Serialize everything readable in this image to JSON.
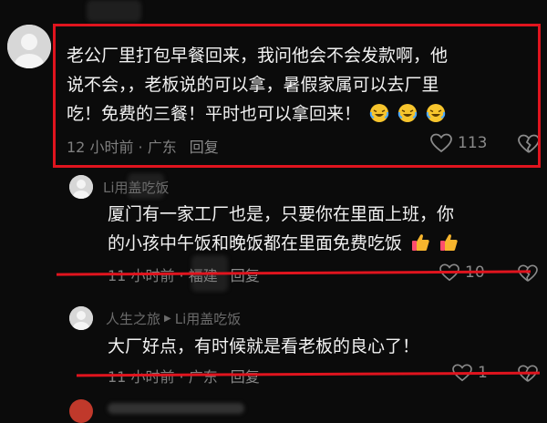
{
  "comments": [
    {
      "lines": [
        "老公厂里打包早餐回来，我问他会不会发款啊，他",
        "说不会，，老板说的可以拿，暑假家属可以去厂里",
        "吃！免费的三餐！平时也可以拿回来！"
      ],
      "time": "12 小时前",
      "location": "广东",
      "reply_label": "回复",
      "likes": "113"
    },
    {
      "username": "Li用盖吃饭",
      "lines": [
        "厦门有一家工厂也是，只要你在里面上班，你",
        "的小孩中午饭和晚饭都在里面免费吃饭"
      ],
      "time": "11 小时前",
      "location": "福建",
      "reply_label": "回复",
      "likes": "10"
    },
    {
      "username": "人生之旅",
      "reply_to": "Li用盖吃饭",
      "lines": [
        "大厂好点，有时候就是看老板的良心了！"
      ],
      "time": "11 小时前",
      "location": "广东",
      "reply_label": "回复",
      "likes": "1"
    }
  ],
  "colors": {
    "annotation_red": "#e0141e",
    "background": "#0b0b0b"
  }
}
